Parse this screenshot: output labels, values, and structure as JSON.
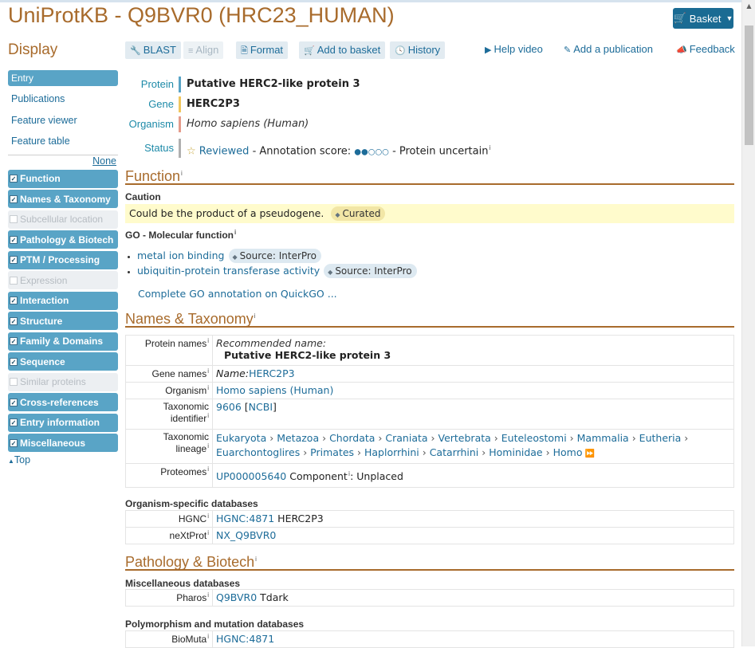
{
  "title": "UniProtKB - Q9BVR0 (HRC23_HUMAN)",
  "basket_label": "Basket",
  "sidebar": {
    "display_title": "Display",
    "entry": "Entry",
    "links": [
      "Publications",
      "Feature viewer",
      "Feature table"
    ],
    "none_label": "None",
    "sections": [
      {
        "label": "Function",
        "on": true
      },
      {
        "label": "Names & Taxonomy",
        "on": true
      },
      {
        "label": "Subcellular location",
        "on": false
      },
      {
        "label": "Pathology & Biotech",
        "on": true
      },
      {
        "label": "PTM / Processing",
        "on": true
      },
      {
        "label": "Expression",
        "on": false
      },
      {
        "label": "Interaction",
        "on": true
      },
      {
        "label": "Structure",
        "on": true
      },
      {
        "label": "Family & Domains",
        "on": true
      },
      {
        "label": "Sequence",
        "on": true
      },
      {
        "label": "Similar proteins",
        "on": false
      },
      {
        "label": "Cross-references",
        "on": true
      },
      {
        "label": "Entry information",
        "on": true
      },
      {
        "label": "Miscellaneous",
        "on": true
      }
    ],
    "top_label": "Top"
  },
  "toolbar": {
    "blast": "BLAST",
    "align": "Align",
    "format": "Format",
    "add_basket": "Add to basket",
    "history": "History",
    "help_video": "Help video",
    "add_publication": "Add a publication",
    "feedback": "Feedback"
  },
  "summary": {
    "protein_label": "Protein",
    "protein": "Putative HERC2-like protein 3",
    "gene_label": "Gene",
    "gene": "HERC2P3",
    "organism_label": "Organism",
    "organism": "Homo sapiens (Human)",
    "status_label": "Status",
    "status_reviewed": "Reviewed",
    "status_annotation": "- Annotation score:",
    "annotation_score": 2,
    "annotation_max": 5,
    "status_evidence": "- Protein uncertain",
    "colors": {
      "protein": "#59a4c6",
      "gene": "#f0c75e",
      "organism": "#e59b8b",
      "status": "#b0b0b0"
    }
  },
  "function": {
    "title": "Function",
    "caution_head": "Caution",
    "caution_text": "Could be the product of a pseudogene.",
    "caution_tag": "Curated",
    "go_head": "GO - Molecular function",
    "go_terms": [
      {
        "term": "metal ion binding",
        "source": "Source: InterPro"
      },
      {
        "term": "ubiquitin-protein transferase activity",
        "source": "Source: InterPro"
      }
    ],
    "complete_go": "Complete GO annotation on QuickGO ..."
  },
  "names_taxonomy": {
    "title": "Names & Taxonomy",
    "protein_names_label": "Protein names",
    "recommended_label": "Recommended name:",
    "recommended_value": "Putative HERC2-like protein 3",
    "gene_names_label": "Gene names",
    "gene_name_prefix": "Name:",
    "gene_name": "HERC2P3",
    "organism_label": "Organism",
    "organism_value": "Homo sapiens (Human)",
    "taxid_label_1": "Taxonomic",
    "taxid_label_2": "identifier",
    "taxid_value": "9606",
    "taxid_source": "NCBI",
    "lineage_label_1": "Taxonomic",
    "lineage_label_2": "lineage",
    "lineage": [
      "Eukaryota",
      "Metazoa",
      "Chordata",
      "Craniata",
      "Vertebrata",
      "Euteleostomi",
      "Mammalia",
      "Eutheria",
      "Euarchontoglires",
      "Primates",
      "Haplorrhini",
      "Catarrhini",
      "Hominidae",
      "Homo"
    ],
    "proteomes_label": "Proteomes",
    "proteome_id": "UP000005640",
    "proteome_component": "Component",
    "proteome_component_value": ": Unplaced",
    "org_db_head": "Organism-specific databases",
    "hgnc_label": "HGNC",
    "hgnc_value": "HGNC:4871",
    "hgnc_gene": "HERC2P3",
    "nextprot_label": "neXtProt",
    "nextprot_value": "NX_Q9BVR0"
  },
  "pathology": {
    "title": "Pathology & Biotech",
    "misc_head": "Miscellaneous databases",
    "pharos_label": "Pharos",
    "pharos_value": "Q9BVR0",
    "pharos_extra": "Tdark",
    "poly_head": "Polymorphism and mutation databases",
    "biomuta_label": "BioMuta",
    "biomuta_value": "HGNC:4871"
  }
}
